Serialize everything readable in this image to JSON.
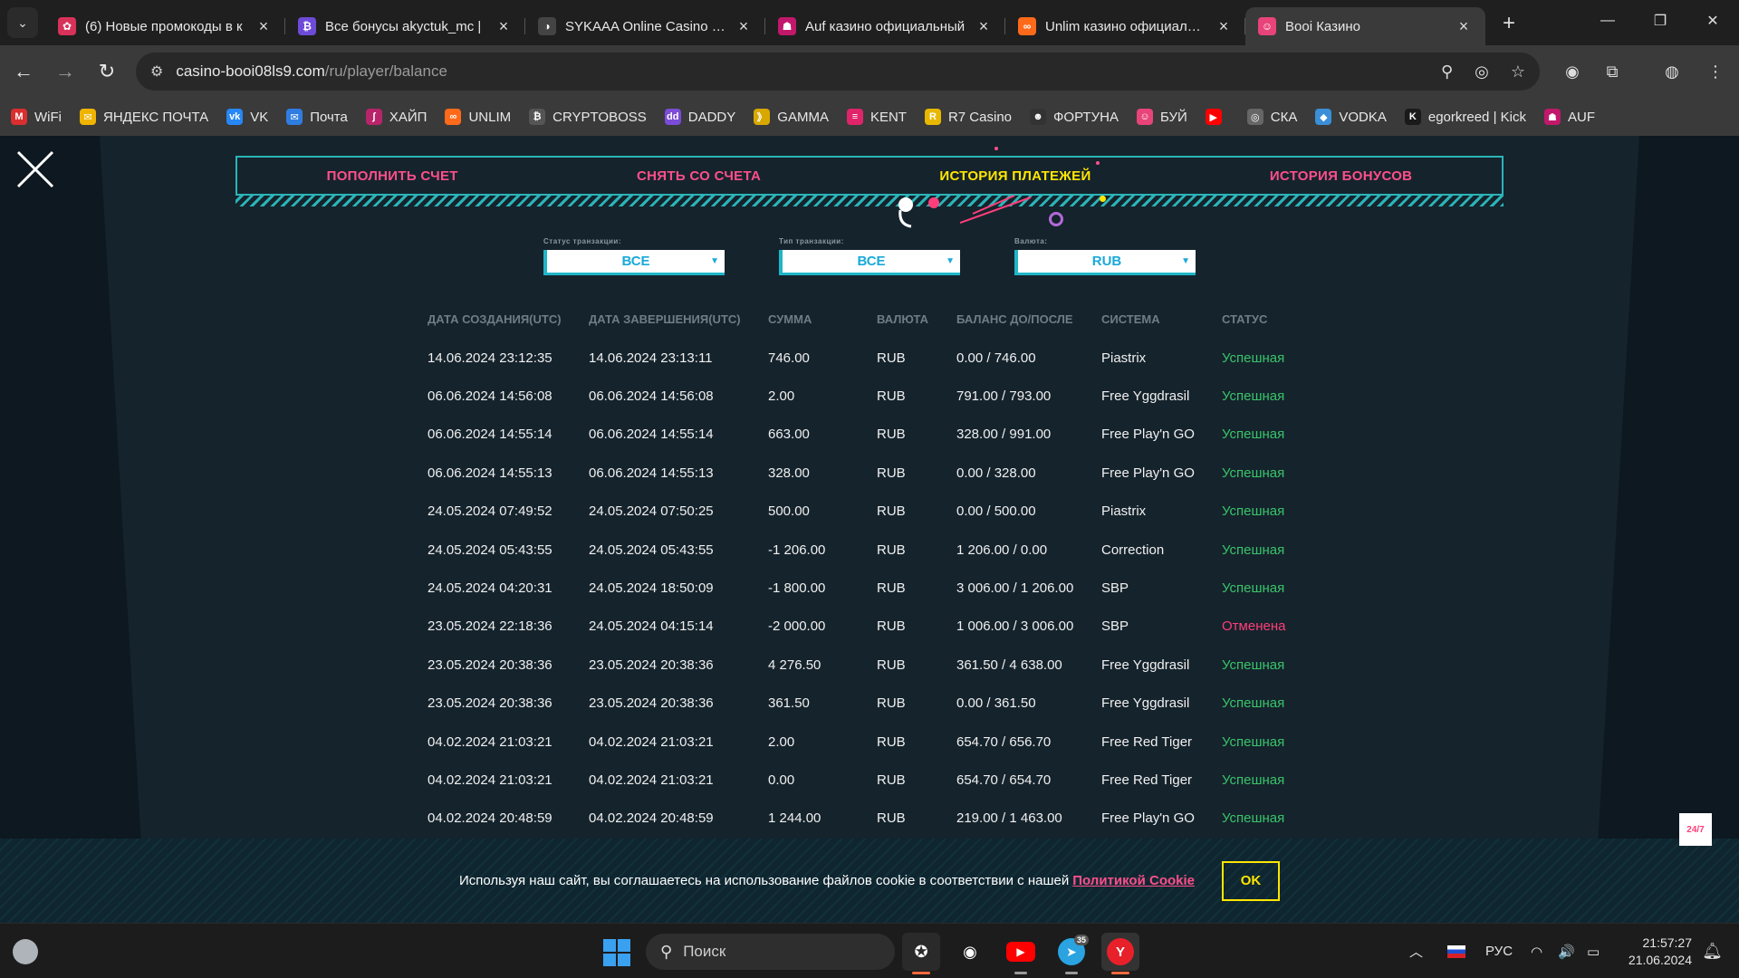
{
  "browser": {
    "tabs": [
      {
        "title": "(6) Новые промокоды в к",
        "color": "#d8325a",
        "glyph": "✿"
      },
      {
        "title": "Все бонусы akyctuk_mc | ",
        "color": "#6d4bd8",
        "glyph": "₿"
      },
      {
        "title": "SYKAAA Online Casino - Г",
        "color": "#444444",
        "glyph": "◑"
      },
      {
        "title": "Auf казино официальный",
        "color": "#c2186b",
        "glyph": "☗"
      },
      {
        "title": "Unlim казино официальны",
        "color": "#ff6a1a",
        "glyph": "∞"
      },
      {
        "title": "Booi Казино",
        "color": "#e8447a",
        "glyph": "☺"
      }
    ],
    "new_tab": "+",
    "url_host": "casino-booi08ls9.com",
    "url_path": "/ru/player/balance",
    "bookmarks": [
      {
        "label": "WiFi",
        "color": "#d92f2f",
        "glyph": "M"
      },
      {
        "label": "ЯНДЕКС ПОЧТА",
        "color": "#f0b400",
        "glyph": "✉"
      },
      {
        "label": "VK",
        "color": "#2787f5",
        "glyph": "vk"
      },
      {
        "label": "Почта",
        "color": "#2f7de1",
        "glyph": "✉"
      },
      {
        "label": "ХАЙП",
        "color": "#b8246a",
        "glyph": "ʃ"
      },
      {
        "label": "UNLIM",
        "color": "#ff6a1a",
        "glyph": "∞"
      },
      {
        "label": "CRYPTOBOSS",
        "color": "#555555",
        "glyph": "₿"
      },
      {
        "label": "DADDY",
        "color": "#7b4cd8",
        "glyph": "dd"
      },
      {
        "label": "GAMMA",
        "color": "#d8a800",
        "glyph": "》"
      },
      {
        "label": "KENT",
        "color": "#e0246a",
        "glyph": "≡"
      },
      {
        "label": "R7 Casino",
        "color": "#e8b800",
        "glyph": "R"
      },
      {
        "label": "ФОРТУНА",
        "color": "#333333",
        "glyph": "☻"
      },
      {
        "label": "БУЙ",
        "color": "#e8447a",
        "glyph": "☺"
      },
      {
        "label": "",
        "color": "#ff0000",
        "glyph": "▶"
      },
      {
        "label": "СКА",
        "color": "#666666",
        "glyph": "◎"
      },
      {
        "label": "VODKA",
        "color": "#3a8fd8",
        "glyph": "◆"
      },
      {
        "label": "egorkreed | Kick",
        "color": "#1a1a1a",
        "glyph": "K"
      },
      {
        "label": "AUF",
        "color": "#c2186b",
        "glyph": "☗"
      }
    ]
  },
  "nav_tabs": [
    {
      "label": "ПОПОЛНИТЬ СЧЕТ",
      "active": false
    },
    {
      "label": "СНЯТЬ СО СЧЕТА",
      "active": false
    },
    {
      "label": "ИСТОРИЯ ПЛАТЕЖЕЙ",
      "active": true
    },
    {
      "label": "ИСТОРИЯ БОНУСОВ",
      "active": false
    }
  ],
  "filters": [
    {
      "label": "Статус транзакции:",
      "value": "ВСЕ"
    },
    {
      "label": "Тип транзакции:",
      "value": "ВСЕ"
    },
    {
      "label": "Валюта:",
      "value": "RUB"
    }
  ],
  "table": {
    "headers": [
      "ДАТА СОЗДАНИЯ(UTC)",
      "ДАТА ЗАВЕРШЕНИЯ(UTC)",
      "СУММА",
      "ВАЛЮТА",
      "БАЛАНС ДО/ПОСЛЕ",
      "СИСТЕМА",
      "СТАТУС"
    ],
    "rows": [
      [
        "14.06.2024 23:12:35",
        "14.06.2024 23:13:11",
        "746.00",
        "RUB",
        "0.00 / 746.00",
        "Piastrix",
        "Успешная"
      ],
      [
        "06.06.2024 14:56:08",
        "06.06.2024 14:56:08",
        "2.00",
        "RUB",
        "791.00 / 793.00",
        "Free Yggdrasil",
        "Успешная"
      ],
      [
        "06.06.2024 14:55:14",
        "06.06.2024 14:55:14",
        "663.00",
        "RUB",
        "328.00 / 991.00",
        "Free Play'n GO",
        "Успешная"
      ],
      [
        "06.06.2024 14:55:13",
        "06.06.2024 14:55:13",
        "328.00",
        "RUB",
        "0.00 / 328.00",
        "Free Play'n GO",
        "Успешная"
      ],
      [
        "24.05.2024 07:49:52",
        "24.05.2024 07:50:25",
        "500.00",
        "RUB",
        "0.00 / 500.00",
        "Piastrix",
        "Успешная"
      ],
      [
        "24.05.2024 05:43:55",
        "24.05.2024 05:43:55",
        "-1 206.00",
        "RUB",
        "1 206.00 / 0.00",
        "Correction",
        "Успешная"
      ],
      [
        "24.05.2024 04:20:31",
        "24.05.2024 18:50:09",
        "-1 800.00",
        "RUB",
        "3 006.00 / 1 206.00",
        "SBP",
        "Успешная"
      ],
      [
        "23.05.2024 22:18:36",
        "24.05.2024 04:15:14",
        "-2 000.00",
        "RUB",
        "1 006.00 / 3 006.00",
        "SBP",
        "Отменена"
      ],
      [
        "23.05.2024 20:38:36",
        "23.05.2024 20:38:36",
        "4 276.50",
        "RUB",
        "361.50 / 4 638.00",
        "Free Yggdrasil",
        "Успешная"
      ],
      [
        "23.05.2024 20:38:36",
        "23.05.2024 20:38:36",
        "361.50",
        "RUB",
        "0.00 / 361.50",
        "Free Yggdrasil",
        "Успешная"
      ],
      [
        "04.02.2024 21:03:21",
        "04.02.2024 21:03:21",
        "2.00",
        "RUB",
        "654.70 / 656.70",
        "Free Red Tiger",
        "Успешная"
      ],
      [
        "04.02.2024 21:03:21",
        "04.02.2024 21:03:21",
        "0.00",
        "RUB",
        "654.70 / 654.70",
        "Free Red Tiger",
        "Успешная"
      ],
      [
        "04.02.2024 20:48:59",
        "04.02.2024 20:48:59",
        "1 244.00",
        "RUB",
        "219.00 / 1 463.00",
        "Free Play'n GO",
        "Успешная"
      ]
    ]
  },
  "cookie": {
    "text": "Используя наш сайт, вы соглашаетесь на использование файлов cookie в соответствии с нашей",
    "link": "Политикой Cookie",
    "ok": "OK"
  },
  "support_badge": "24/7",
  "taskbar": {
    "search_placeholder": "Поиск",
    "telegram_badge": "35",
    "language": "РУС",
    "time": "21:57:27",
    "date": "21.06.2024"
  },
  "colors": {
    "accent_pink": "#ff4f8b",
    "accent_yellow": "#ffe600",
    "accent_teal": "#2bb4b8",
    "success": "#39c46a",
    "cancelled": "#ff3e7a"
  }
}
